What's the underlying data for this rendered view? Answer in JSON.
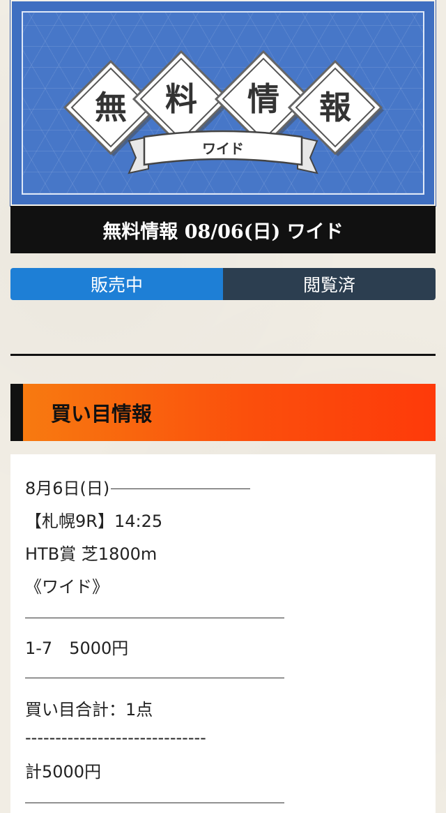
{
  "banner": {
    "chars": [
      "無",
      "料",
      "情",
      "報"
    ],
    "ribbon": "ワイド",
    "colors": {
      "background": "#4777c8",
      "diamond": "#ffffff"
    }
  },
  "title": "無料情報 08/06(日) ワイド",
  "tabs": [
    {
      "label": "販売中",
      "active": true
    },
    {
      "label": "閲覧済",
      "active": false
    }
  ],
  "section": {
    "title": "買い目情報"
  },
  "content": {
    "date": "8月6日(日)",
    "race": "【札幌9R】14:25",
    "race_name": "HTB賞 芝1800m",
    "bet_type": "《ワイド》",
    "bet": "1-7　5000円",
    "total_points": "買い目合計：1点",
    "dashes": "------------------------------",
    "total_amount": "計5000円"
  },
  "colors": {
    "tab_active": "#1e7fd6",
    "tab_inactive": "#2c3e50",
    "section_gradient_start": "#f77a10",
    "section_gradient_end": "#fe3a0a"
  }
}
